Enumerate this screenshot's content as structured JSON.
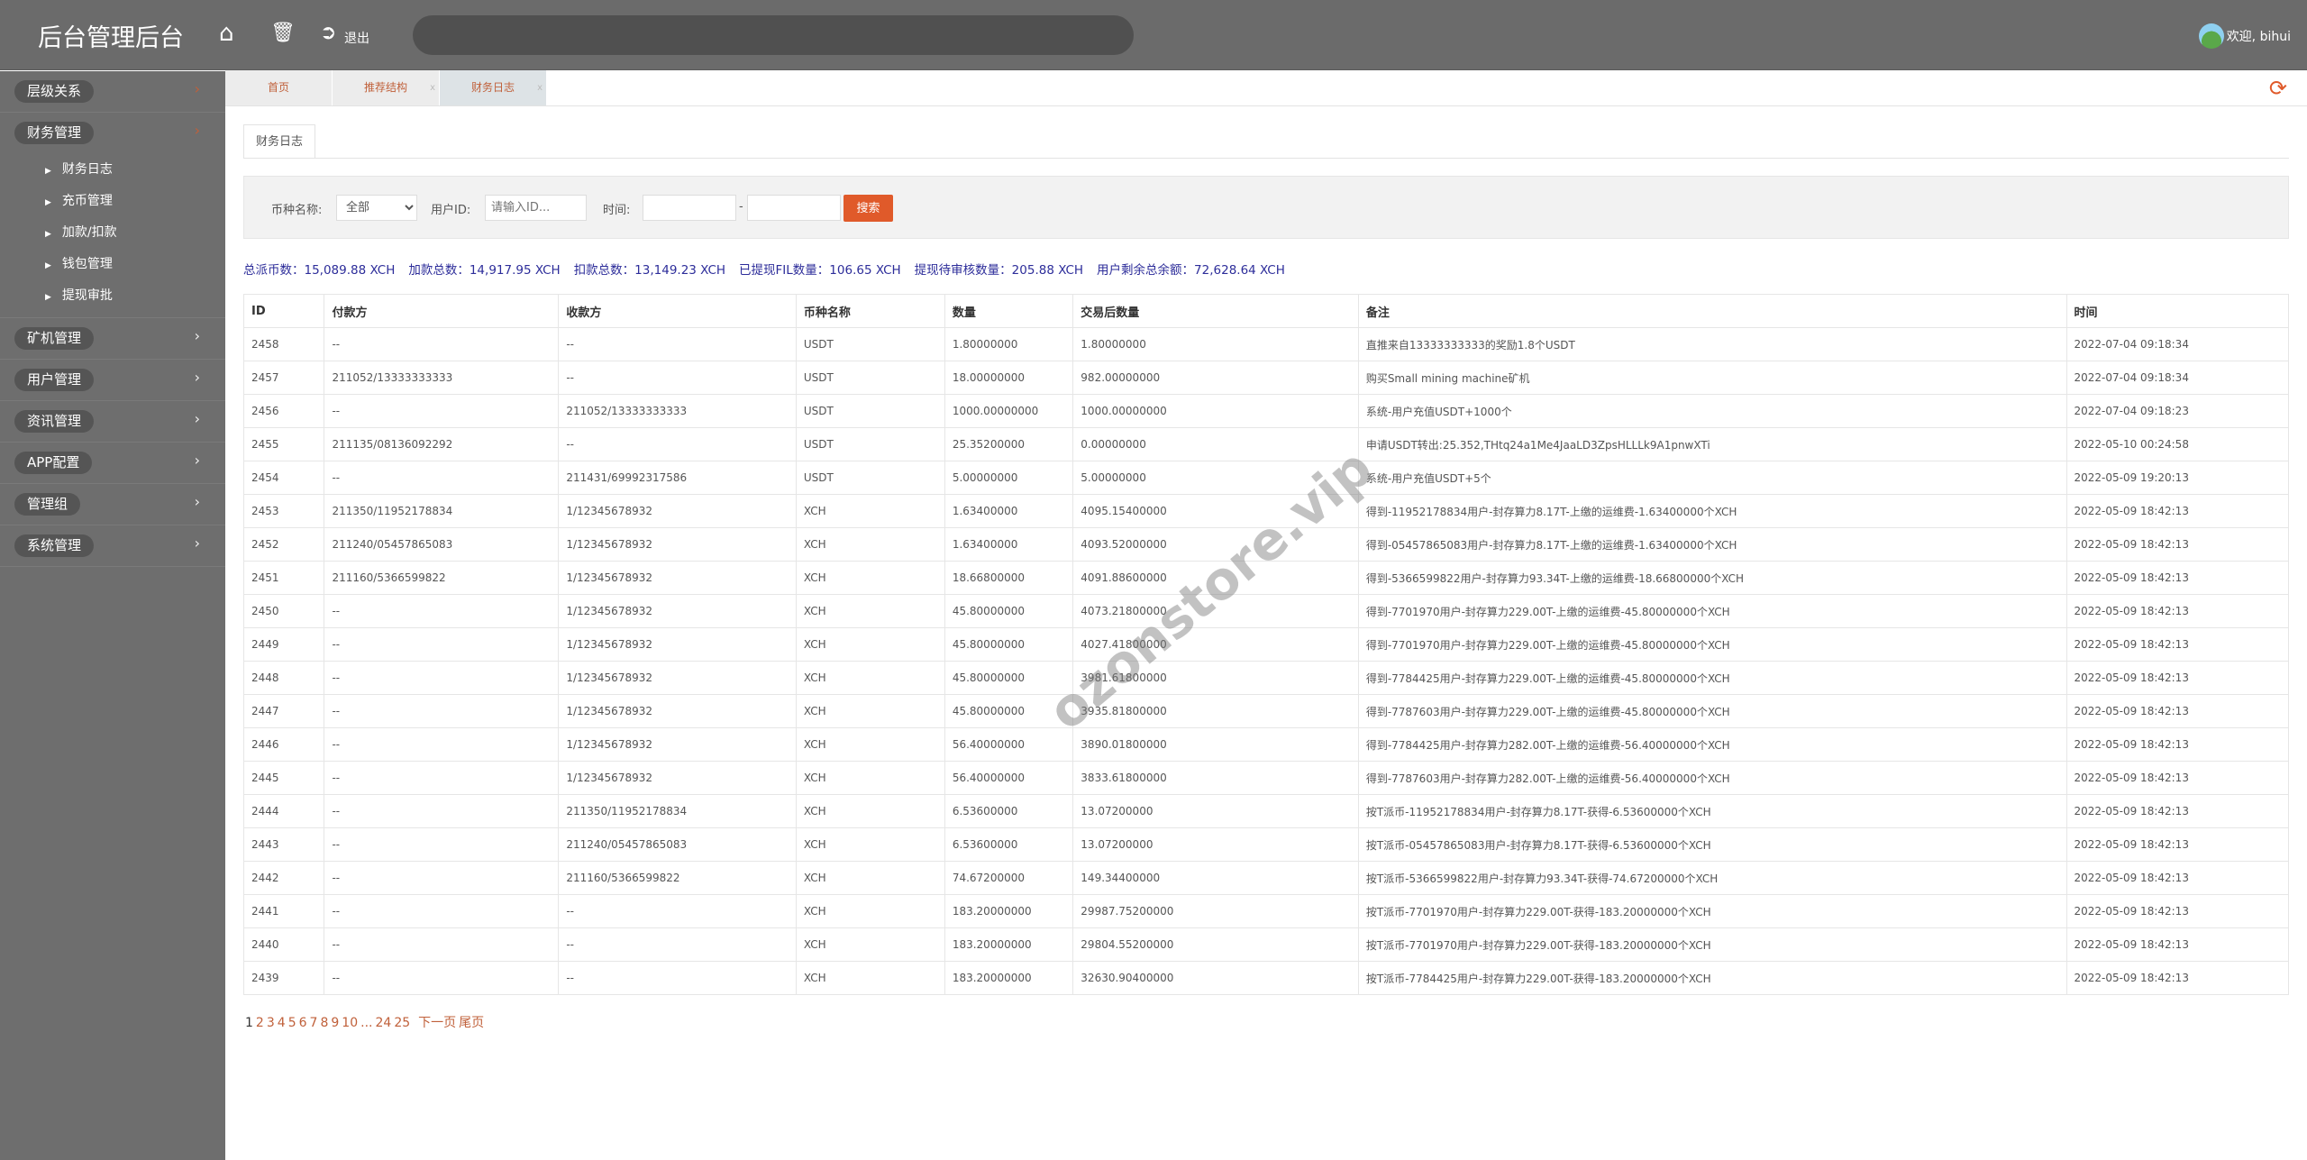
{
  "header": {
    "title": "后台管理后台",
    "logout_label": "退出",
    "welcome": "欢迎, bihui"
  },
  "sidebar": {
    "groups": [
      {
        "label": "层级关系",
        "expanded": false
      },
      {
        "label": "财务管理",
        "expanded": true,
        "items": [
          "财务日志",
          "充币管理",
          "加款/扣款",
          "钱包管理",
          "提现审批"
        ]
      },
      {
        "label": "矿机管理"
      },
      {
        "label": "用户管理"
      },
      {
        "label": "资讯管理"
      },
      {
        "label": "APP配置"
      },
      {
        "label": "管理组"
      },
      {
        "label": "系统管理"
      }
    ]
  },
  "page_tabs": [
    {
      "label": "首页"
    },
    {
      "label": "推荐结构",
      "close": "x"
    },
    {
      "label": "财务日志",
      "close": "x",
      "active": true
    }
  ],
  "content_tab": "财务日志",
  "filter": {
    "coin_label": "币种名称:",
    "coin_value": "全部",
    "user_label": "用户ID:",
    "user_placeholder": "请输入ID...",
    "time_label": "时间:",
    "time_sep": "-",
    "search_label": "搜索"
  },
  "stats": [
    "总派币数：15,089.88 XCH",
    "加款总数：14,917.95 XCH",
    "扣款总数：13,149.23 XCH",
    "已提现FIL数量：106.65 XCH",
    "提现待审核数量：205.88 XCH",
    "用户剩余总余额：72,628.64 XCH"
  ],
  "table": {
    "columns": [
      "ID",
      "付款方",
      "收款方",
      "币种名称",
      "数量",
      "交易后数量",
      "备注",
      "时间"
    ],
    "rows": [
      [
        "2458",
        "--",
        "--",
        "USDT",
        "1.80000000",
        "1.80000000",
        "直推来自13333333333的奖励1.8个USDT",
        "2022-07-04 09:18:34"
      ],
      [
        "2457",
        "211052/13333333333",
        "--",
        "USDT",
        "18.00000000",
        "982.00000000",
        "购买Small mining machine矿机",
        "2022-07-04 09:18:34"
      ],
      [
        "2456",
        "--",
        "211052/13333333333",
        "USDT",
        "1000.00000000",
        "1000.00000000",
        "系统-用户充值USDT+1000个",
        "2022-07-04 09:18:23"
      ],
      [
        "2455",
        "211135/08136092292",
        "--",
        "USDT",
        "25.35200000",
        "0.00000000",
        "申请USDT转出:25.352,THtq24a1Me4JaaLD3ZpsHLLLk9A1pnwXTi",
        "2022-05-10 00:24:58"
      ],
      [
        "2454",
        "--",
        "211431/69992317586",
        "USDT",
        "5.00000000",
        "5.00000000",
        "系统-用户充值USDT+5个",
        "2022-05-09 19:20:13"
      ],
      [
        "2453",
        "211350/11952178834",
        "1/12345678932",
        "XCH",
        "1.63400000",
        "4095.15400000",
        "得到-11952178834用户-封存算力8.17T-上缴的运维费-1.63400000个XCH",
        "2022-05-09 18:42:13"
      ],
      [
        "2452",
        "211240/05457865083",
        "1/12345678932",
        "XCH",
        "1.63400000",
        "4093.52000000",
        "得到-05457865083用户-封存算力8.17T-上缴的运维费-1.63400000个XCH",
        "2022-05-09 18:42:13"
      ],
      [
        "2451",
        "211160/5366599822",
        "1/12345678932",
        "XCH",
        "18.66800000",
        "4091.88600000",
        "得到-5366599822用户-封存算力93.34T-上缴的运维费-18.66800000个XCH",
        "2022-05-09 18:42:13"
      ],
      [
        "2450",
        "--",
        "1/12345678932",
        "XCH",
        "45.80000000",
        "4073.21800000",
        "得到-7701970用户-封存算力229.00T-上缴的运维费-45.80000000个XCH",
        "2022-05-09 18:42:13"
      ],
      [
        "2449",
        "--",
        "1/12345678932",
        "XCH",
        "45.80000000",
        "4027.41800000",
        "得到-7701970用户-封存算力229.00T-上缴的运维费-45.80000000个XCH",
        "2022-05-09 18:42:13"
      ],
      [
        "2448",
        "--",
        "1/12345678932",
        "XCH",
        "45.80000000",
        "3981.61800000",
        "得到-7784425用户-封存算力229.00T-上缴的运维费-45.80000000个XCH",
        "2022-05-09 18:42:13"
      ],
      [
        "2447",
        "--",
        "1/12345678932",
        "XCH",
        "45.80000000",
        "3935.81800000",
        "得到-7787603用户-封存算力229.00T-上缴的运维费-45.80000000个XCH",
        "2022-05-09 18:42:13"
      ],
      [
        "2446",
        "--",
        "1/12345678932",
        "XCH",
        "56.40000000",
        "3890.01800000",
        "得到-7784425用户-封存算力282.00T-上缴的运维费-56.40000000个XCH",
        "2022-05-09 18:42:13"
      ],
      [
        "2445",
        "--",
        "1/12345678932",
        "XCH",
        "56.40000000",
        "3833.61800000",
        "得到-7787603用户-封存算力282.00T-上缴的运维费-56.40000000个XCH",
        "2022-05-09 18:42:13"
      ],
      [
        "2444",
        "--",
        "211350/11952178834",
        "XCH",
        "6.53600000",
        "13.07200000",
        "按T派币-11952178834用户-封存算力8.17T-获得-6.53600000个XCH",
        "2022-05-09 18:42:13"
      ],
      [
        "2443",
        "--",
        "211240/05457865083",
        "XCH",
        "6.53600000",
        "13.07200000",
        "按T派币-05457865083用户-封存算力8.17T-获得-6.53600000个XCH",
        "2022-05-09 18:42:13"
      ],
      [
        "2442",
        "--",
        "211160/5366599822",
        "XCH",
        "74.67200000",
        "149.34400000",
        "按T派币-5366599822用户-封存算力93.34T-获得-74.67200000个XCH",
        "2022-05-09 18:42:13"
      ],
      [
        "2441",
        "--",
        "--",
        "XCH",
        "183.20000000",
        "29987.75200000",
        "按T派币-7701970用户-封存算力229.00T-获得-183.20000000个XCH",
        "2022-05-09 18:42:13"
      ],
      [
        "2440",
        "--",
        "--",
        "XCH",
        "183.20000000",
        "29804.55200000",
        "按T派币-7701970用户-封存算力229.00T-获得-183.20000000个XCH",
        "2022-05-09 18:42:13"
      ],
      [
        "2439",
        "--",
        "--",
        "XCH",
        "183.20000000",
        "32630.90400000",
        "按T派币-7784425用户-封存算力229.00T-获得-183.20000000个XCH",
        "2022-05-09 18:42:13"
      ]
    ]
  },
  "pagination": {
    "current": "1",
    "pages": [
      "2",
      "3",
      "4",
      "5",
      "6",
      "7",
      "8",
      "9",
      "10"
    ],
    "ellipsis": "...",
    "last_pages": [
      "24",
      "25"
    ],
    "next": "下一页",
    "last": "尾页"
  },
  "watermark": "ozonstore.vip",
  "colors": {
    "header": "#6b6b6b",
    "sidebar": "#6e6e6e",
    "accent": "#e05a2a",
    "stats": "#2d2d9a"
  }
}
